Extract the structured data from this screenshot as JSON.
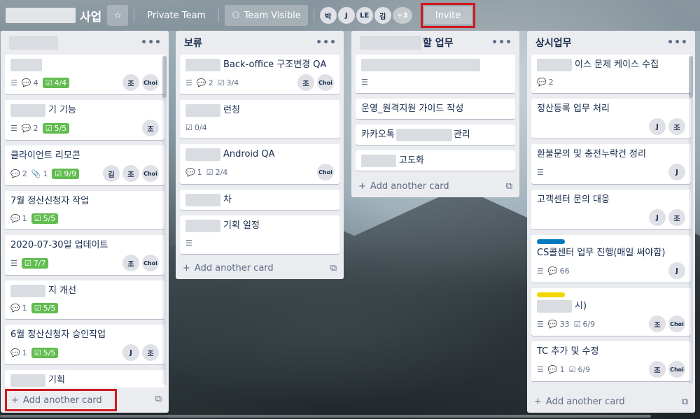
{
  "header": {
    "board_title_suffix": "사업",
    "private_team": "Private Team",
    "team_visible": "Team Visible",
    "members": [
      "박",
      "J",
      "LE",
      "김"
    ],
    "more_members": "+3",
    "invite": "Invite"
  },
  "add_card": "Add another card",
  "lists": [
    {
      "title": "",
      "cards": [
        {
          "title": "",
          "desc": true,
          "comments": "4",
          "checklist": "4/4",
          "members": [
            "조",
            "Choi"
          ]
        },
        {
          "title": "기 기능",
          "desc": true,
          "comments": "2",
          "checklist": "5/5",
          "members": [
            "조"
          ]
        },
        {
          "title": "클라이언트 리모콘",
          "comments": "2",
          "attachments": "1",
          "checklist": "9/9",
          "members": [
            "김",
            "조",
            "Choi"
          ]
        },
        {
          "title": "7월 정산신청자 작업",
          "comments": "1",
          "checklist": "5/5",
          "members": []
        },
        {
          "title": "2020-07-30일 업데이트",
          "desc": true,
          "checklist": "7/7",
          "members": [
            "조",
            "Choi"
          ]
        },
        {
          "title": "지 개선",
          "comments": "1",
          "checklist": "5/5",
          "members": []
        },
        {
          "title": "6월 정산신청자 승인작업",
          "comments": "1",
          "checklist": "5/5",
          "members": [
            "J",
            "조"
          ]
        },
        {
          "title": "기획",
          "members": []
        }
      ]
    },
    {
      "title": "보류",
      "cards": [
        {
          "title": "Back-office 구조변경 QA",
          "desc": true,
          "comments": "2",
          "checklist": "3/4",
          "members": [
            "조",
            "Choi"
          ]
        },
        {
          "title": "런칭",
          "checklist": "0/4",
          "members": []
        },
        {
          "title": "Android QA",
          "comments": "1",
          "checklist": "2/4",
          "members": [
            "Choi"
          ]
        },
        {
          "title": "차",
          "members": []
        },
        {
          "title": "기획 일정",
          "desc": true,
          "members": []
        }
      ]
    },
    {
      "title": "할 업무",
      "cards": [
        {
          "title": "",
          "desc": true,
          "members": []
        },
        {
          "title": "운영_원격지원 가이드 작성",
          "members": []
        },
        {
          "title": "카카오톡",
          "title_suffix": "관리",
          "members": []
        },
        {
          "title": "고도화",
          "members": []
        }
      ]
    },
    {
      "title": "상시업무",
      "cards": [
        {
          "title": "이스 문제 케이스 수집",
          "comments": "2",
          "members": []
        },
        {
          "title": "정산등록 업무 처리",
          "members": [
            "J",
            "조"
          ]
        },
        {
          "title": "환불문의 및 충전누락건 정리",
          "desc": true,
          "members": [
            "J"
          ]
        },
        {
          "title": "고객센터 문의 대응",
          "members": [
            "J",
            "조"
          ]
        },
        {
          "title": "CS콜센터 업무 진행(매일 써야함)",
          "label": "#0079bf",
          "desc": true,
          "comments": "66",
          "members": [
            "J"
          ]
        },
        {
          "title": "시)",
          "label": "#f2d600",
          "desc": true,
          "comments": "33",
          "checklist": "6/9",
          "members": [
            "조",
            "Choi"
          ]
        },
        {
          "title": "TC 추가 및 수정",
          "desc": true,
          "comments": "1",
          "checklist": "6/9",
          "members": [
            "조",
            "Choi"
          ]
        }
      ]
    }
  ]
}
